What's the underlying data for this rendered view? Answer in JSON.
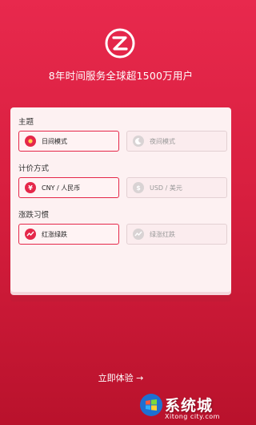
{
  "header": {
    "tagline": "8年时间服务全球超1500万用户"
  },
  "settings": {
    "theme": {
      "label": "主题",
      "options": [
        {
          "label": "日间模式",
          "icon": "sun-icon",
          "selected": true
        },
        {
          "label": "夜间模式",
          "icon": "moon-icon",
          "selected": false
        }
      ]
    },
    "currency": {
      "label": "计价方式",
      "options": [
        {
          "label": "CNY / 人民币",
          "icon": "yuan-icon",
          "selected": true
        },
        {
          "label": "USD / 美元",
          "icon": "dollar-icon",
          "selected": false
        }
      ]
    },
    "color_habit": {
      "label": "涨跌习惯",
      "options": [
        {
          "label": "红涨绿跌",
          "icon": "trend-icon",
          "selected": true
        },
        {
          "label": "绿涨红跌",
          "icon": "trend-icon",
          "selected": false
        }
      ]
    }
  },
  "cta": {
    "label": "立即体验 →"
  },
  "watermark": {
    "text": "系统城",
    "sub": "Xitong city.com"
  },
  "colors": {
    "accent": "#e5284a",
    "background": "#d81f3f",
    "card": "#fdf1f2"
  }
}
